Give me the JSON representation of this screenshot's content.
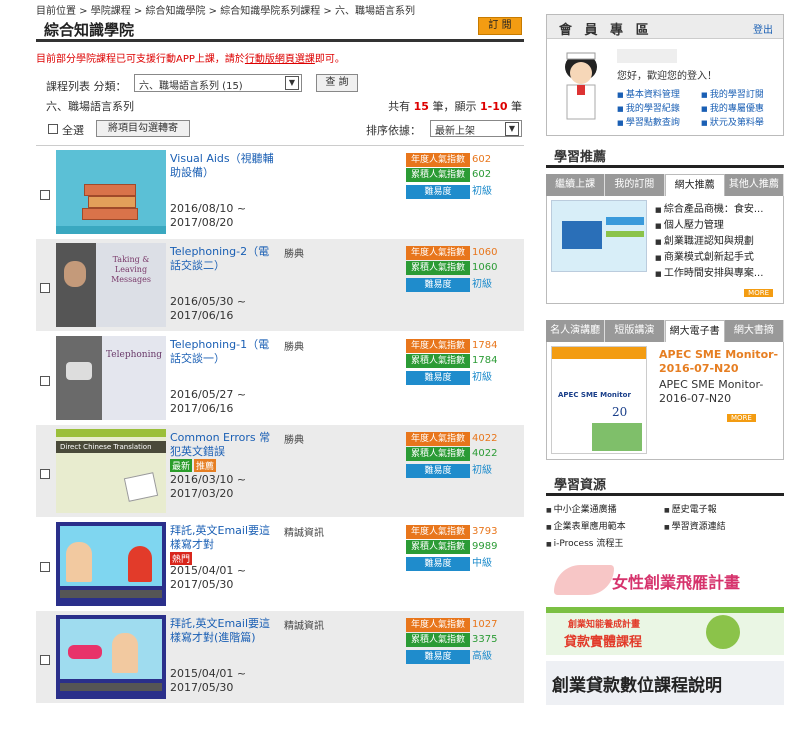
{
  "breadcrumb": "目前位置 > 學院課程 > 綜合知識學院 > 綜合知識學院系列課程 > 六、職場語言系列",
  "page": {
    "title": "綜合知識學院",
    "subscribe": "訂 閱",
    "notice_pre": "目前部分學院課程已可支援行動APP上課，請於",
    "notice_link": "行動版網頁選課",
    "notice_post": "即可。",
    "filter_label": "課程列表 分類：",
    "filter_value": "六、職場語言系列 (15)",
    "query_button": "查 詢",
    "category": "六、職場語言系列",
    "count_pre": "共有",
    "count_total": "15",
    "count_mid": "筆，顯示",
    "count_range": "1-10",
    "count_post": "筆",
    "select_all": "全選",
    "add_button": "將項目勾選轉寄",
    "sort_label": "排序依據：",
    "sort_value": "最新上架"
  },
  "stat_labels": {
    "annual": "年度人氣指數",
    "total": "累積人氣指數",
    "difficulty": "難易度"
  },
  "courses": [
    {
      "name": "Visual Aids（視聽輔助設備）",
      "author": "",
      "start": "2016/08/10 ~",
      "end": "2017/08/20",
      "annual": "602",
      "total": "602",
      "level": "初級"
    },
    {
      "name": "Telephoning-2（電話交談二）",
      "author": "勝典",
      "start": "2016/05/30 ~",
      "end": "2017/06/16",
      "annual": "1060",
      "total": "1060",
      "level": "初級"
    },
    {
      "name": "Telephoning-1（電話交談一）",
      "author": "勝典",
      "start": "2016/05/27 ~",
      "end": "2017/06/16",
      "annual": "1784",
      "total": "1784",
      "level": "初級"
    },
    {
      "name": "Common Errors 常犯英文錯誤",
      "author": "勝典",
      "badge_new": "最新",
      "badge_hot": "推薦",
      "start": "2016/03/10 ~",
      "end": "2017/03/20",
      "annual": "4022",
      "total": "4022",
      "level": "初級"
    },
    {
      "name": "拜託,英文Email要這樣寫才對",
      "author": "精誠資訊",
      "badge_hot": "熱門",
      "start": "2015/04/01 ~",
      "end": "2017/05/30",
      "annual": "3793",
      "total": "9989",
      "level": "中級"
    },
    {
      "name": "拜託,英文Email要這樣寫才對(進階篇)",
      "author": "精誠資訊",
      "start": "2015/04/01 ~",
      "end": "2017/05/30",
      "annual": "1027",
      "total": "3375",
      "level": "高級"
    }
  ],
  "thumbs": {
    "c2": "Taking & Leaving Messages",
    "c3": "Telephoning",
    "c4": "Direct Chinese Translation"
  },
  "member": {
    "title": "會 員 專 區",
    "logout": "登出",
    "hello": "您好，歡迎您的登入！",
    "links": [
      "基本資料管理",
      "我的學習訂閱",
      "我的學習紀錄",
      "我的專屬優惠",
      "學習點數查詢",
      "狀元及第料舉"
    ]
  },
  "recommend": {
    "title": "學習推薦",
    "tabs": [
      "繼續上課",
      "我的訂閱",
      "網大推薦",
      "其他人推薦"
    ],
    "items": [
      "綜合產品商機：食安...",
      "個人壓力管理",
      "創業職涯認知與規劃",
      "商業模式創新起手式",
      "工作時間安排與專案..."
    ],
    "more": "MORE"
  },
  "ebook": {
    "tabs": [
      "名人演講廳",
      "短版講演",
      "網大電子書",
      "網大書摘"
    ],
    "title_orange": "APEC SME Monitor-2016-07-N20",
    "title_black": "APEC SME Monitor-2016-07-N20",
    "cover_text": "APEC SME Monitor",
    "cover_num": "20",
    "more": "MORE"
  },
  "resources": {
    "title": "學習資源",
    "items": [
      "中小企業通廣播",
      "歷史電子報",
      "企業表單應用範本",
      "學習資源連結",
      "i-Process 流程王"
    ]
  },
  "banners": {
    "b1": "女性創業飛雁計畫",
    "b2a": "創業知能養成計畫",
    "b2b": "貸款實體課程",
    "b3": "創業貸款數位課程說明"
  }
}
